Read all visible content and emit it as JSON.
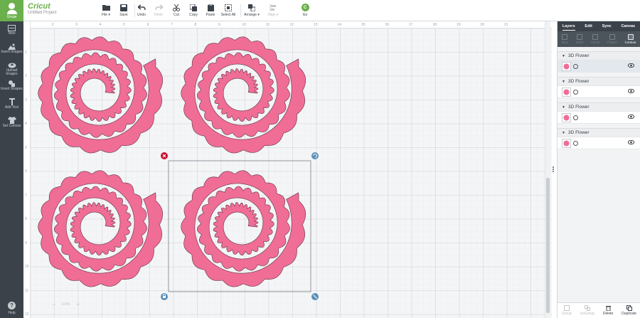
{
  "app": {
    "logo": "Cricut",
    "project_title": "Untitled Project"
  },
  "sidebar": {
    "user_label": "Greg▾",
    "items": [
      {
        "label": "New",
        "icon": "new-icon"
      },
      {
        "label": "Insert Images",
        "icon": "image-icon"
      },
      {
        "label": "Upload Images",
        "icon": "upload-icon"
      },
      {
        "label": "Insert Shapes",
        "icon": "shapes-icon"
      },
      {
        "label": "Add Text",
        "icon": "text-icon"
      },
      {
        "label": "Set Canvas",
        "icon": "shirt-icon"
      }
    ],
    "help": "Help"
  },
  "toolbar": {
    "file": "File ▾",
    "save": "Save",
    "undo": "Undo",
    "redo": "Redo",
    "cut": "Cut",
    "copy": "Copy",
    "paste": "Paste",
    "select_all": "Select All",
    "arrange": "Arrange ▾",
    "align": "Align ▾",
    "go": "Go",
    "go_badge": "C"
  },
  "ruler": {
    "top": [
      "2",
      "3",
      "4",
      "5",
      "6",
      "7",
      "8",
      "9",
      "10",
      "11",
      "12",
      "13",
      "14",
      "15",
      "16",
      "17",
      "18",
      "19",
      "20",
      "21"
    ],
    "left": [
      "1",
      "2",
      "3",
      "4",
      "5",
      "6",
      "7",
      "8",
      "9",
      "10",
      "11",
      "12"
    ]
  },
  "zoom": {
    "minus": "−",
    "value": "100%",
    "plus": "+"
  },
  "panel": {
    "tabs": [
      "Layers",
      "Edit",
      "Sync",
      "Canvas"
    ],
    "tools": [
      "Slice",
      "Weld",
      "Attach",
      "Flatten",
      "Contour"
    ],
    "groups": [
      {
        "name": "3D Flower"
      },
      {
        "name": "3D Flower"
      },
      {
        "name": "3D Flower"
      },
      {
        "name": "3D Flower"
      }
    ],
    "footer": [
      "Group",
      "UnGroup",
      "Delete",
      "Duplicate"
    ]
  },
  "colors": {
    "flower": "#f06d96",
    "accent": "#6ab04c",
    "sidebar": "#3b424a"
  }
}
